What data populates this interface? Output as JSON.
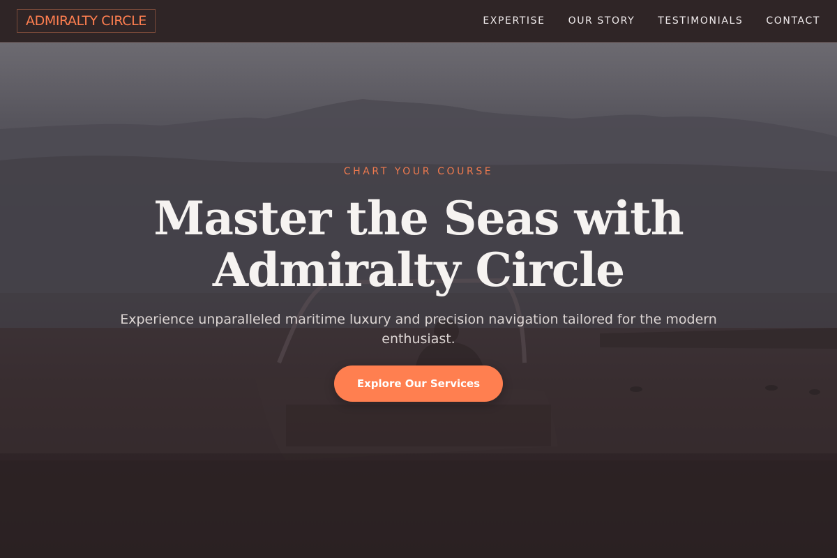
{
  "brand": {
    "name": "ADMIRALTY CIRCLE",
    "accent": "#ff7f50"
  },
  "nav": {
    "links": [
      "EXPERTISE",
      "OUR STORY",
      "TESTIMONIALS",
      "CONTACT"
    ]
  },
  "hero": {
    "eyebrow": "CHART YOUR COURSE",
    "headline_line1": "Master the Seas with",
    "headline_line2": "Admiralty Circle",
    "subheadline": "Experience unparalleled maritime luxury and precision navigation tailored for the modern enthusiast.",
    "cta_label": "Explore Our Services",
    "background_image": "misty-lake-boat-photo"
  },
  "colors": {
    "nav_background": "#2f2526",
    "overlay_dark": "#2b2222",
    "text_light": "#f6f3f1"
  }
}
